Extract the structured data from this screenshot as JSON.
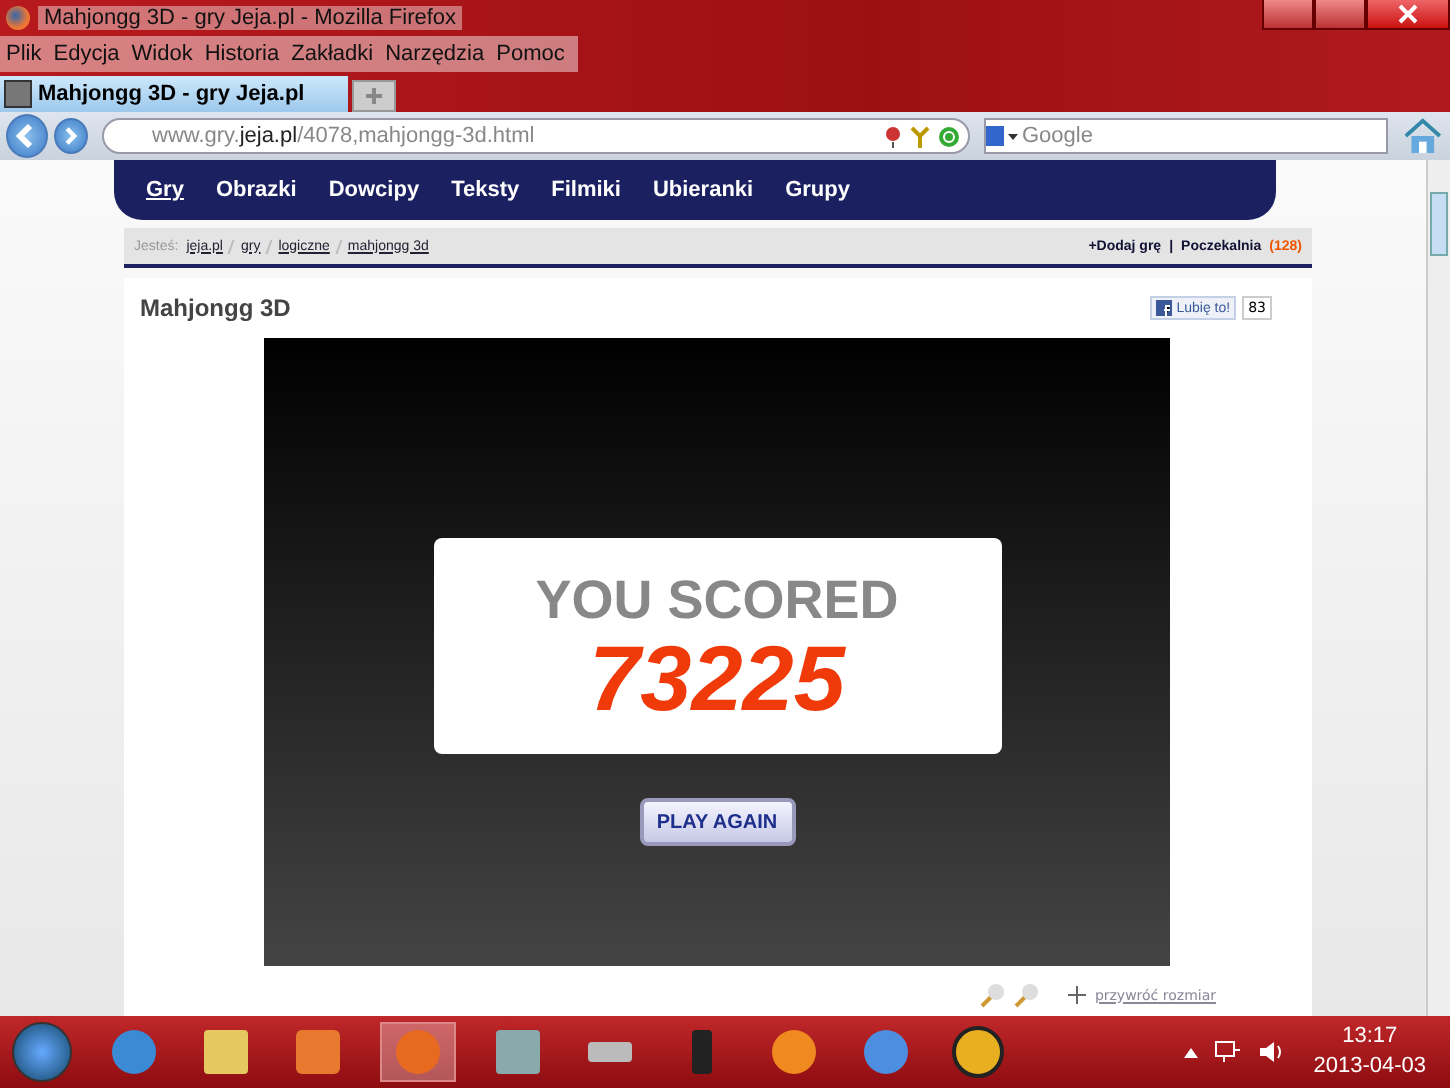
{
  "window": {
    "title": "Mahjongg 3D - gry Jeja.pl - Mozilla Firefox"
  },
  "menu": [
    "Plik",
    "Edycja",
    "Widok",
    "Historia",
    "Zakładki",
    "Narzędzia",
    "Pomoc"
  ],
  "tabs": [
    {
      "label": "Mahjongg 3D - gry Jeja.pl",
      "selected": true
    }
  ],
  "address": {
    "value_prefix": "www.gry.",
    "value_domain": "jeja.pl",
    "value_path": "/4078,mahjongg-3d.html"
  },
  "search": {
    "placeholder": "Google"
  },
  "site_nav": [
    {
      "label": "Gry",
      "selected": true
    },
    {
      "label": "Obrazki",
      "selected": false
    },
    {
      "label": "Dowcipy",
      "selected": false
    },
    {
      "label": "Teksty",
      "selected": false
    },
    {
      "label": "Filmiki",
      "selected": false
    },
    {
      "label": "Ubieranki",
      "selected": false
    },
    {
      "label": "Grupy",
      "selected": false
    }
  ],
  "breadcrumb": {
    "label": "Jesteś:",
    "items": [
      "jeja.pl",
      "gry",
      "logiczne",
      "mahjongg 3d"
    ]
  },
  "actions": {
    "add_game": "+Dodaj grę",
    "separator": "|",
    "waiting": "Poczekalnia",
    "waiting_count_open": "(",
    "waiting_count": "128",
    "waiting_count_close": ")"
  },
  "game": {
    "title": "Mahjongg 3D",
    "like_label": "Lubię to!",
    "like_count": "83",
    "score_heading": "YOU SCORED",
    "score": "73225",
    "play_again": "PLAY AGAIN",
    "restore_link": "przywróć rozmiar"
  },
  "taskbar": {
    "time": "13:17",
    "date": "2013-04-03"
  }
}
